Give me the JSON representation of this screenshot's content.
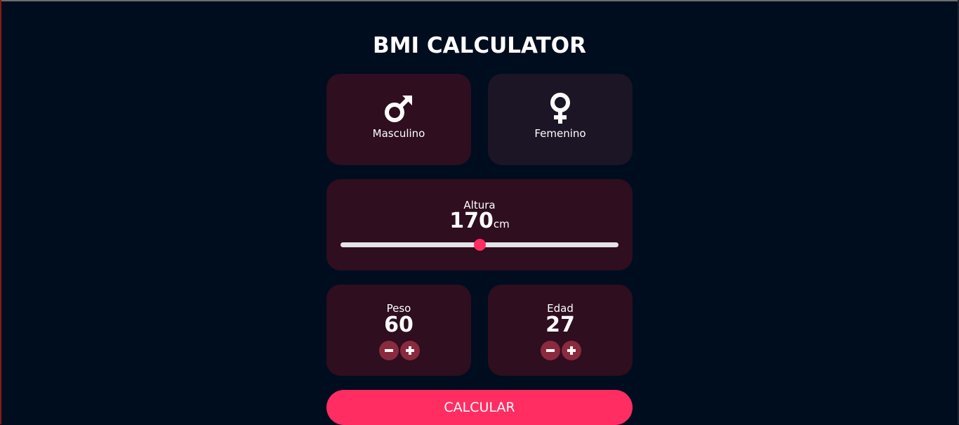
{
  "app": {
    "title": "BMI CALCULATOR"
  },
  "gender": {
    "selected": "male",
    "male": {
      "label": "Masculino",
      "icon": "male-symbol-icon"
    },
    "female": {
      "label": "Femenino",
      "icon": "female-symbol-icon"
    }
  },
  "height": {
    "label": "Altura",
    "value": "170",
    "unit": "cm",
    "slider_fraction": 0.5
  },
  "weight": {
    "label": "Peso",
    "value": "60"
  },
  "age": {
    "label": "Edad",
    "value": "27"
  },
  "actions": {
    "calculate_label": "CALCULAR"
  },
  "colors": {
    "background": "#000d1f",
    "card_active": "#2e0e1f",
    "card_inactive": "#1c1526",
    "accent": "#ff2d62",
    "stepper_button": "#8a2a3f",
    "slider_track": "#e6e3e8"
  }
}
